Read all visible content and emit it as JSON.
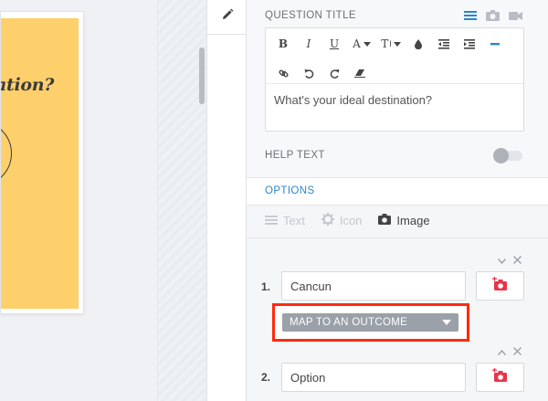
{
  "canvas": {
    "card_title": "ation?"
  },
  "panel": {
    "question_title_label": "QUESTION TITLE",
    "question_text": "What's your ideal destination?",
    "help_text_label": "HELP TEXT",
    "options_label": "OPTIONS",
    "type_tabs": [
      {
        "label": "Text",
        "icon": "lines-icon",
        "active": false
      },
      {
        "label": "Icon",
        "icon": "gear-icon",
        "active": false
      },
      {
        "label": "Image",
        "icon": "camera-icon",
        "active": true
      }
    ],
    "options": [
      {
        "number": "1.",
        "value": "Cancun",
        "map_label": "MAP TO AN OUTCOME"
      },
      {
        "number": "2.",
        "value": "Option"
      }
    ],
    "toolbar": {
      "bold": "B",
      "italic": "I",
      "underline": "U",
      "font_color": "A",
      "text_size": "T"
    }
  },
  "colors": {
    "accent_blue": "#2b87c6",
    "highlight_red": "#ff2a0e",
    "card_yellow": "#fdd06b",
    "image_add_red": "#e8344a"
  }
}
